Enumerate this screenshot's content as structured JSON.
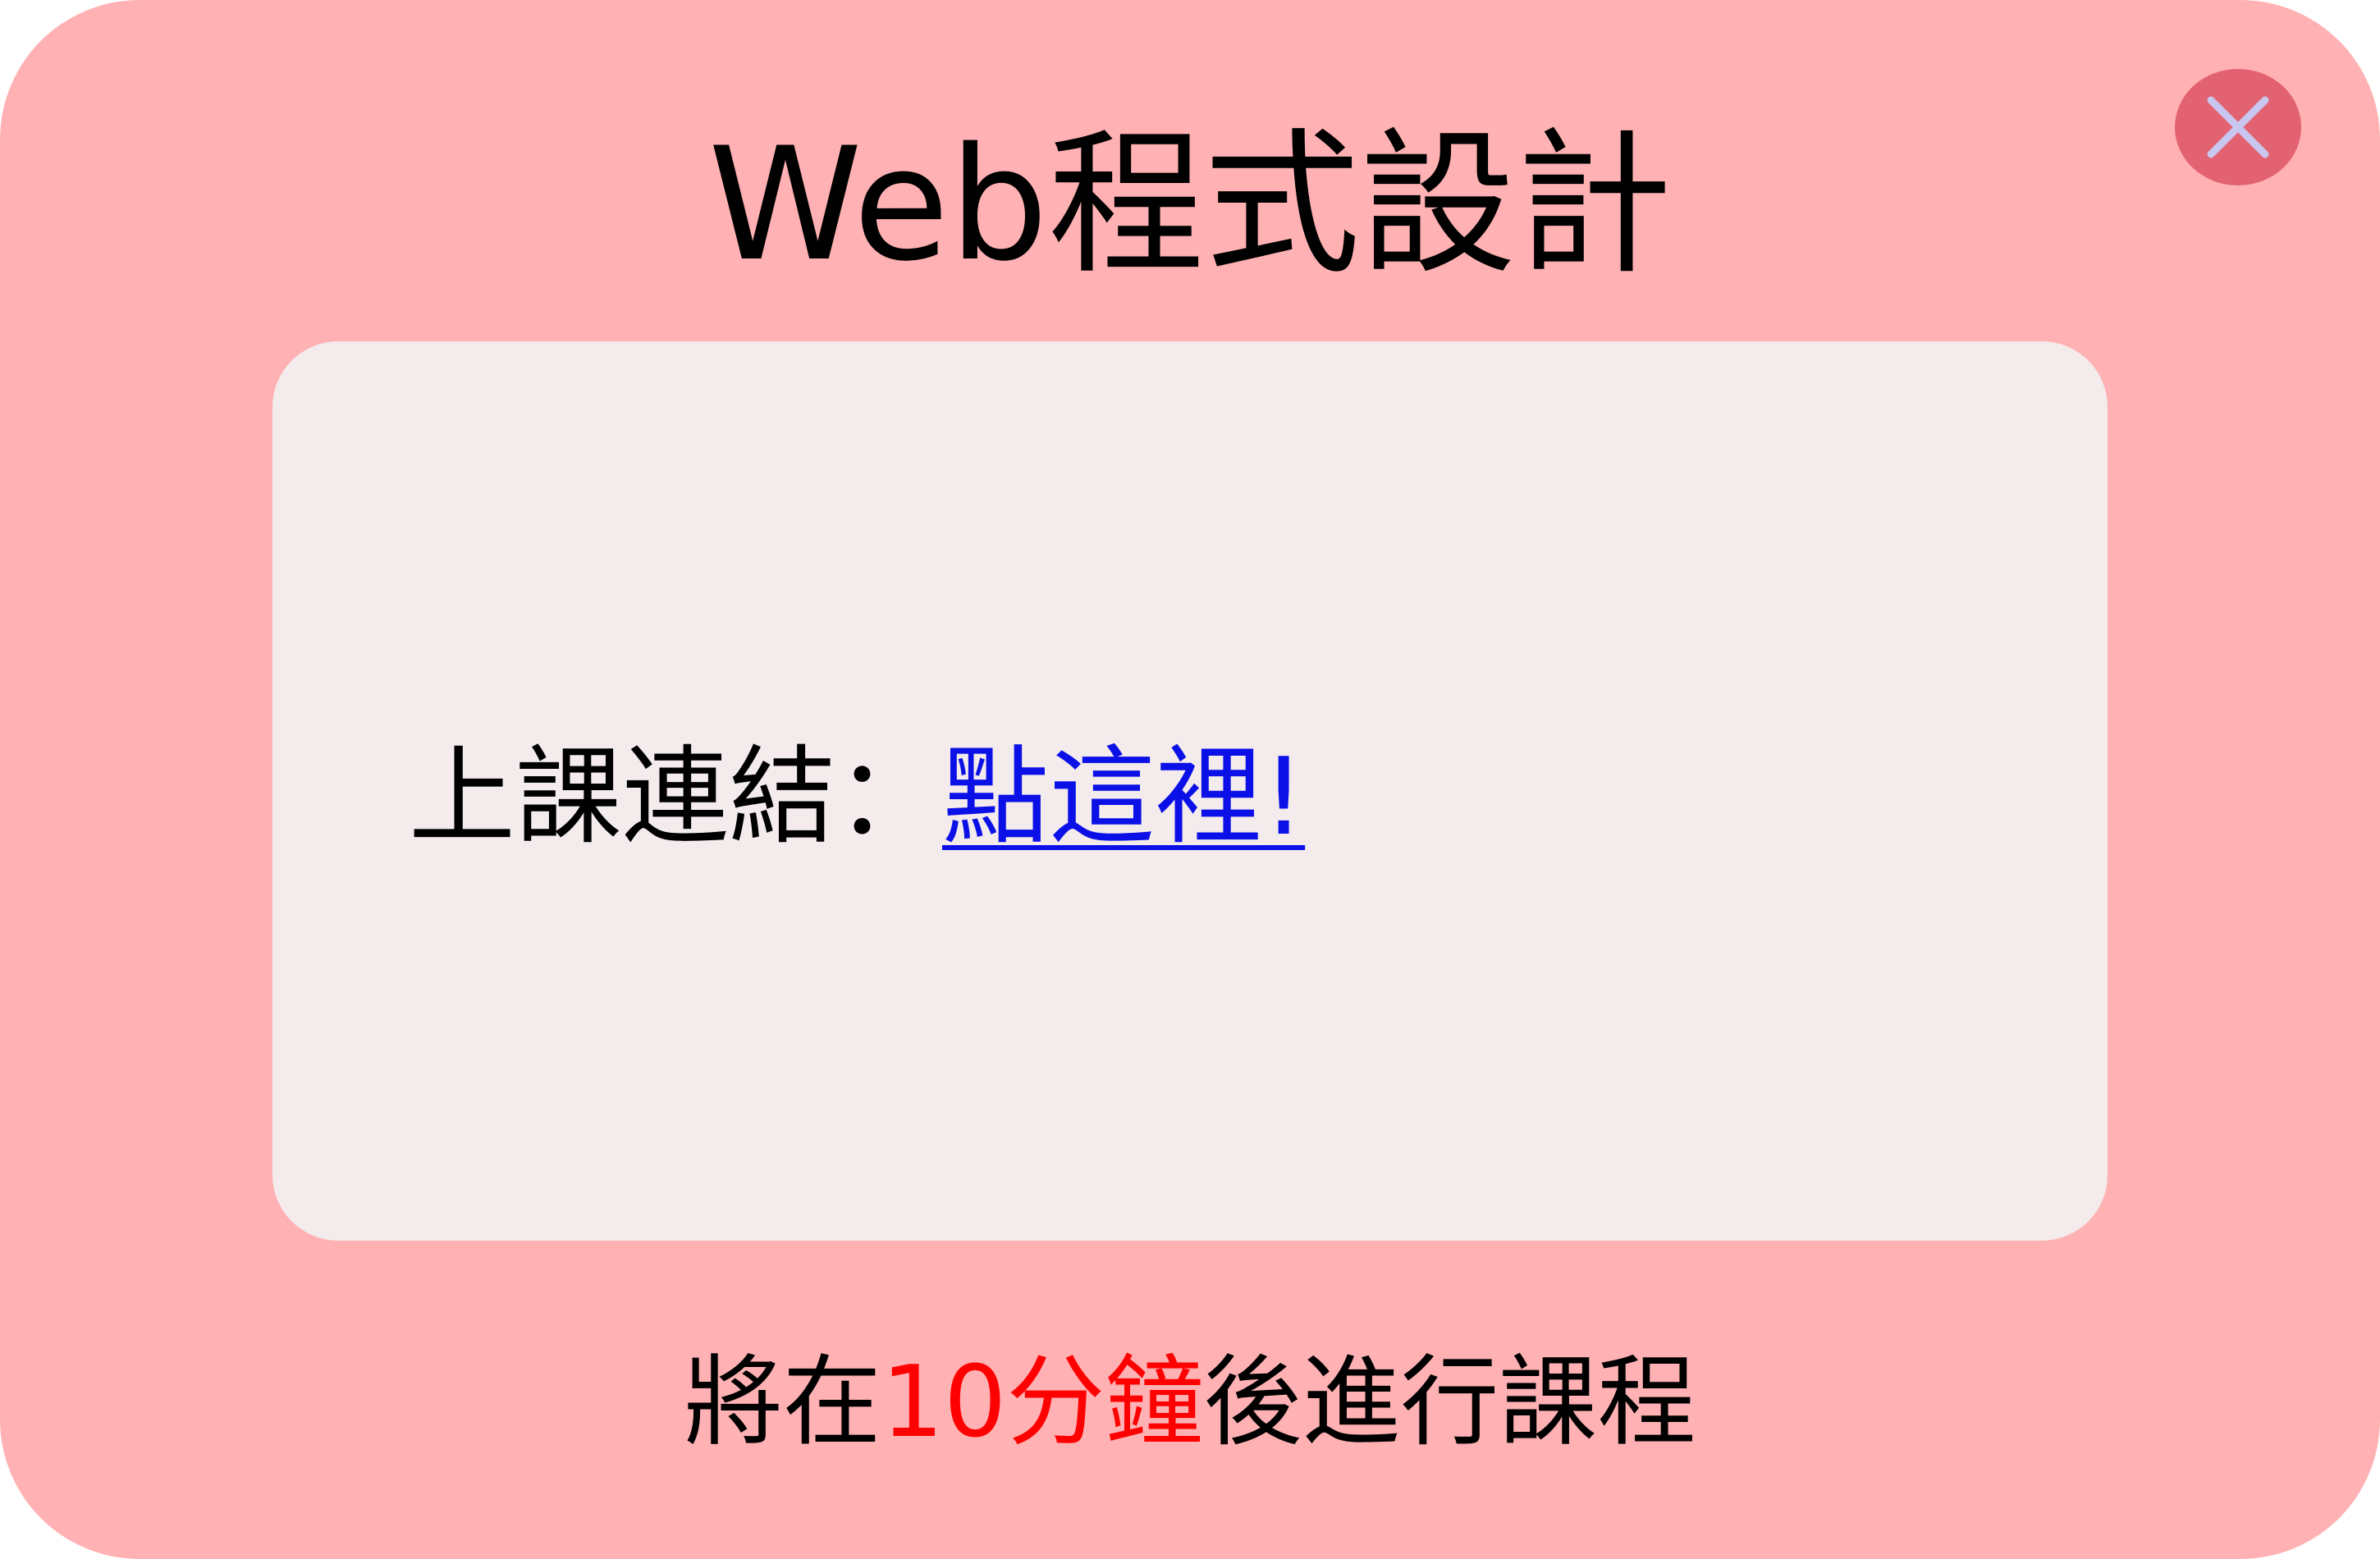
{
  "dialog": {
    "title": "Web程式設計",
    "close_icon": "close-icon",
    "colors": {
      "background": "#ffb1b3",
      "content_background": "#f3ebec",
      "close_button": "#e36271",
      "close_glyph": "#c9c6f0",
      "link": "#0b10e6",
      "highlight": "#ff0000"
    }
  },
  "content": {
    "label": "上課連結：",
    "link_text": "點這裡!"
  },
  "footer": {
    "prefix": "將在",
    "highlight": "10分鐘",
    "suffix": "後進行課程"
  }
}
